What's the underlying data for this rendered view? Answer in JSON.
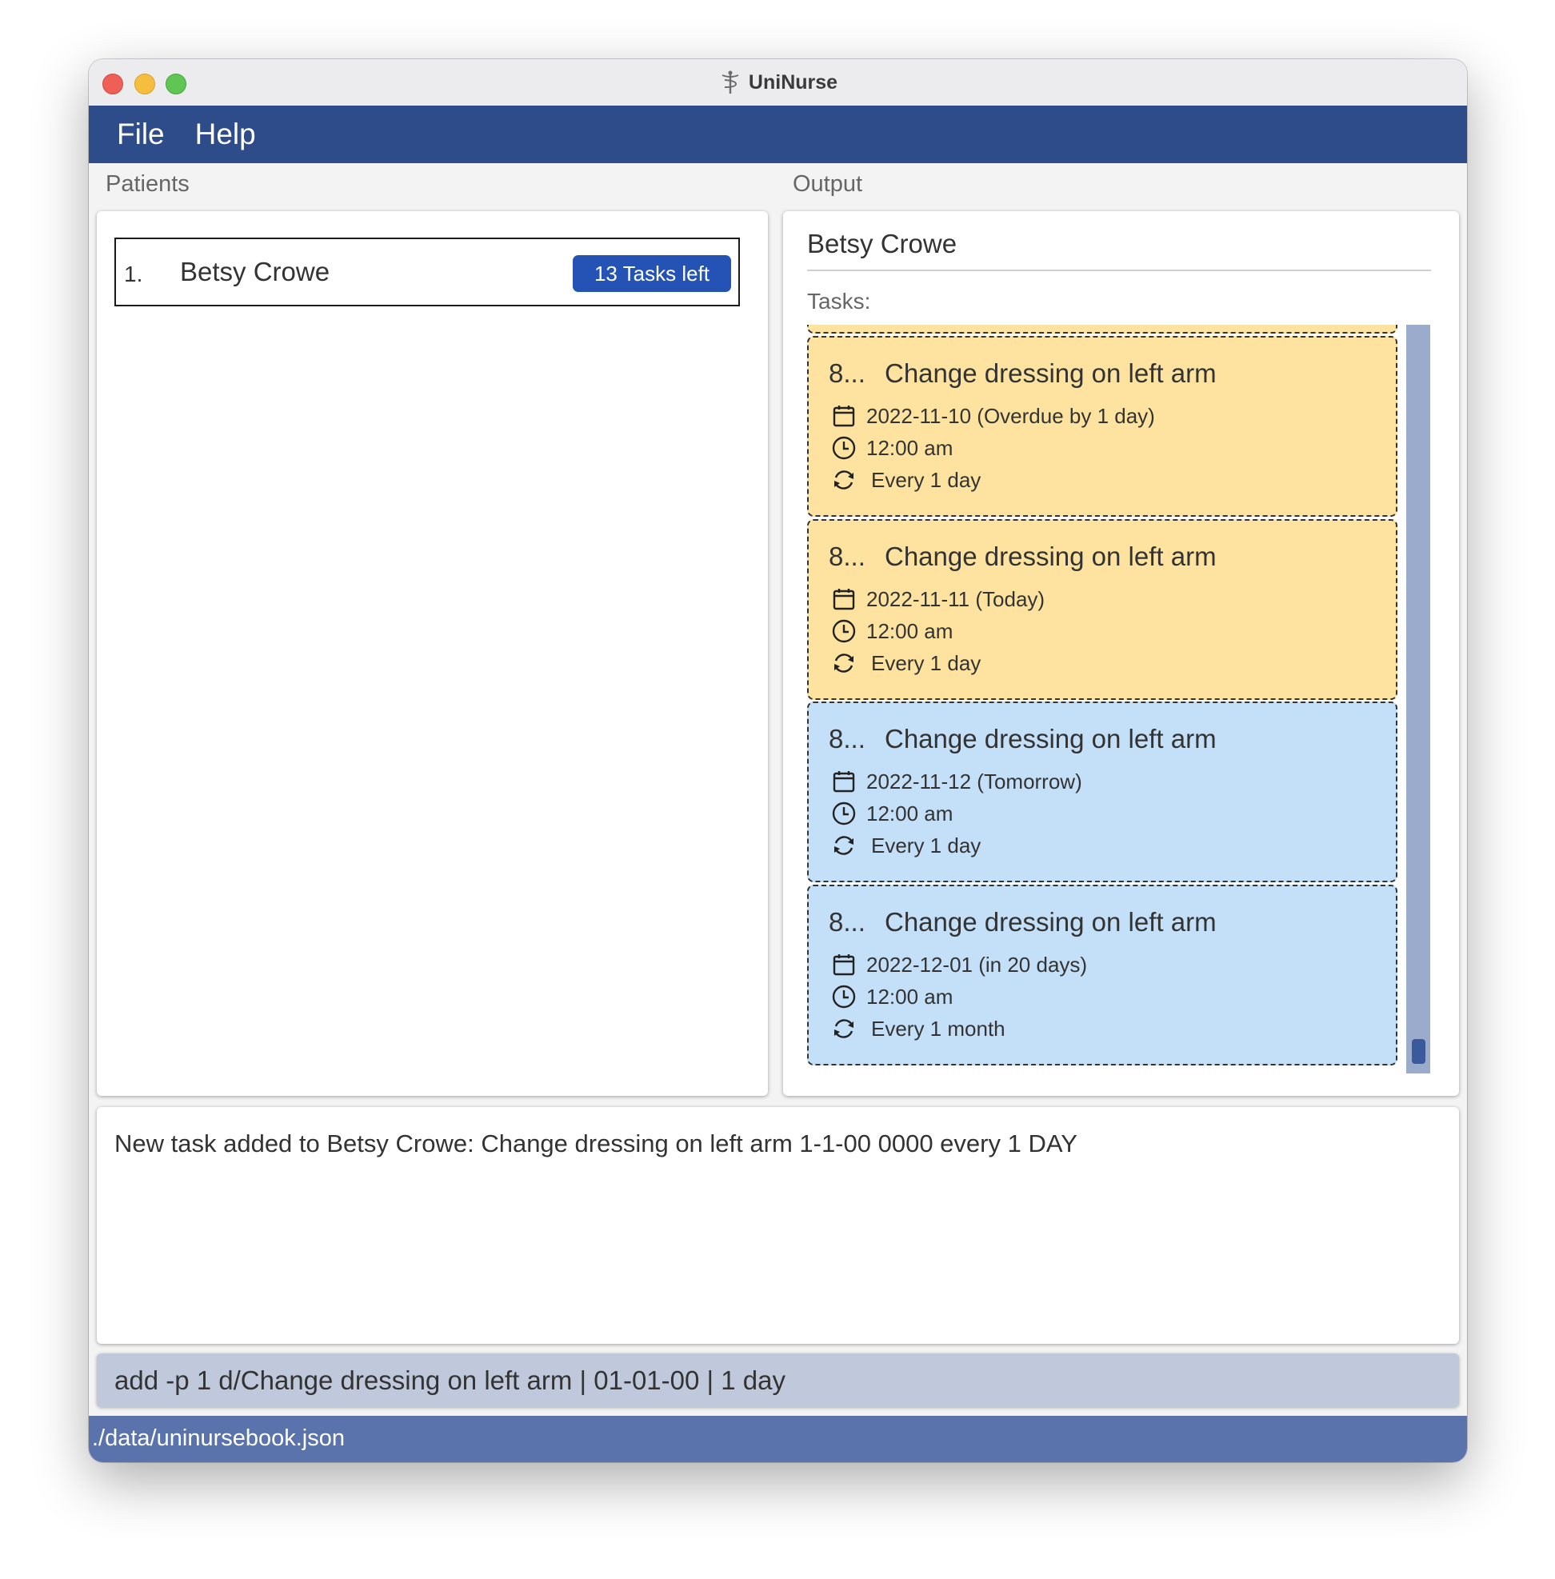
{
  "window": {
    "title": "UniNurse"
  },
  "menu": {
    "items": [
      "File",
      "Help"
    ]
  },
  "patients": {
    "label": "Patients",
    "list": [
      {
        "index": "1.",
        "name": "Betsy Crowe",
        "badge": "13 Tasks left"
      }
    ]
  },
  "output": {
    "label": "Output",
    "patient_name": "Betsy Crowe",
    "tasks_label": "Tasks:",
    "tasks": [
      {
        "num": "8...",
        "description": "Change dressing on left arm",
        "date": "2022-11-10 (Overdue by 1 day)",
        "time": "12:00 am",
        "recurrence": "Every 1 day",
        "status": "overdue"
      },
      {
        "num": "8...",
        "description": "Change dressing on left arm",
        "date": "2022-11-11 (Today)",
        "time": "12:00 am",
        "recurrence": "Every 1 day",
        "status": "today"
      },
      {
        "num": "8...",
        "description": "Change dressing on left arm",
        "date": "2022-11-12 (Tomorrow)",
        "time": "12:00 am",
        "recurrence": "Every 1 day",
        "status": "upcoming"
      },
      {
        "num": "8...",
        "description": "Change dressing on left arm",
        "date": "2022-12-01 (in 20 days)",
        "time": "12:00 am",
        "recurrence": "Every 1 month",
        "status": "upcoming"
      }
    ]
  },
  "result": {
    "message": "New task added to Betsy Crowe: Change dressing on left arm 1-1-00 0000 every 1 DAY"
  },
  "command": {
    "value": "add -p 1 d/Change dressing on left arm | 01-01-00 | 1 day"
  },
  "status_bar": {
    "path": "./data/uninursebook.json"
  },
  "colors": {
    "menubar": "#2e4b8a",
    "badge": "#2553b5",
    "task_due": "#fde39f",
    "task_upcoming": "#c4dff8",
    "statusbar": "#5b73ac",
    "command_box": "#c0c9dc",
    "scrollbar_track": "#9aabcc"
  },
  "icons": {
    "app": "caduceus-icon",
    "date": "calendar-icon",
    "time": "clock-icon",
    "recurrence": "refresh-icon"
  }
}
